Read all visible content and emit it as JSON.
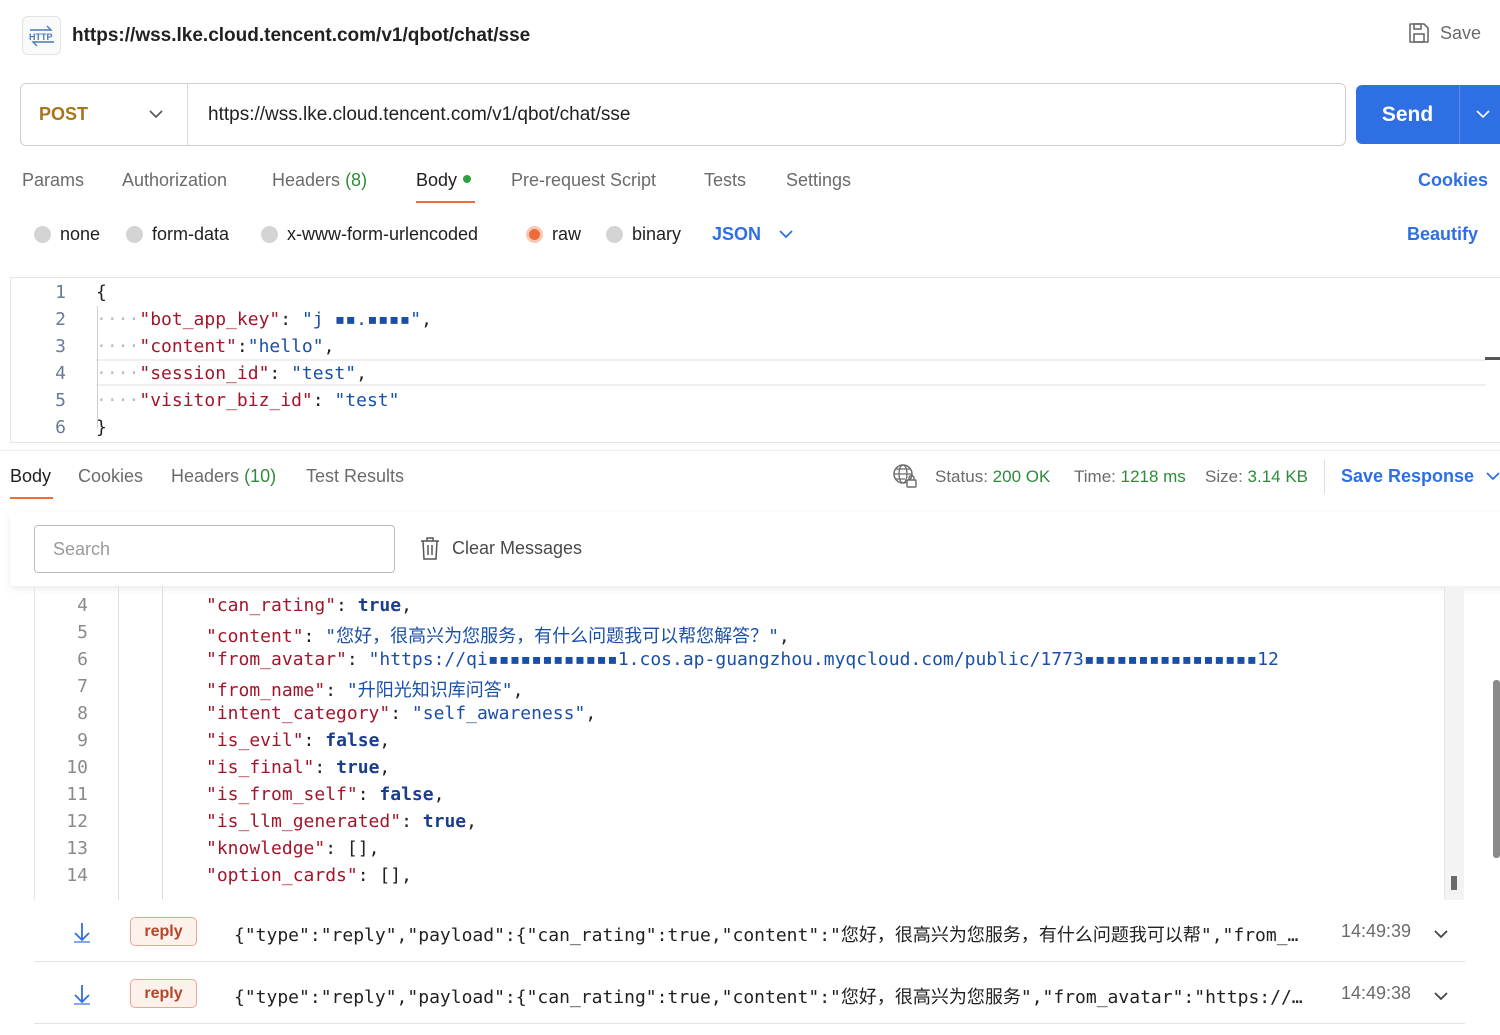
{
  "header": {
    "icon_label": "HTTP",
    "title": "https://wss.lke.cloud.tencent.com/v1/qbot/chat/sse",
    "save_label": "Save"
  },
  "request": {
    "method": "POST",
    "url": "https://wss.lke.cloud.tencent.com/v1/qbot/chat/sse",
    "send_label": "Send",
    "cookies_label": "Cookies",
    "tabs": [
      {
        "label": "Params"
      },
      {
        "label": "Authorization"
      },
      {
        "label": "Headers",
        "count": "(8)"
      },
      {
        "label": "Body"
      },
      {
        "label": "Pre-request Script"
      },
      {
        "label": "Tests"
      },
      {
        "label": "Settings"
      }
    ],
    "body_types": [
      "none",
      "form-data",
      "x-www-form-urlencoded",
      "raw",
      "binary"
    ],
    "selected_body_type": "raw",
    "format": "JSON",
    "beautify_label": "Beautify",
    "editor": {
      "line_numbers": [
        "1",
        "2",
        "3",
        "4",
        "5",
        "6"
      ],
      "open_brace": "{",
      "close_brace": "}",
      "fields": [
        {
          "key": "\"bot_app_key\"",
          "sep": ": ",
          "value": "\"j ▪▪.▪▪▪▪\"",
          "trail": ","
        },
        {
          "key": "\"content\"",
          "sep": ":",
          "value": "\"hello\"",
          "trail": ","
        },
        {
          "key": "\"session_id\"",
          "sep": ": ",
          "value": "\"test\"",
          "trail": ","
        },
        {
          "key": "\"visitor_biz_id\"",
          "sep": ": ",
          "value": "\"test\"",
          "trail": ""
        }
      ]
    }
  },
  "response": {
    "tabs": [
      {
        "label": "Body"
      },
      {
        "label": "Cookies"
      },
      {
        "label": "Headers",
        "count": "(10)"
      },
      {
        "label": "Test Results"
      }
    ],
    "status_label": "Status:",
    "status_value": "200 OK",
    "time_label": "Time:",
    "time_value": "1218 ms",
    "size_label": "Size:",
    "size_value": "3.14 KB",
    "save_response_label": "Save Response",
    "search_placeholder": "Search",
    "clear_messages_label": "Clear Messages",
    "viewer": {
      "lines": [
        {
          "n": "4",
          "key": "\"can_rating\"",
          "value": "true",
          "kind": "kw"
        },
        {
          "n": "5",
          "key": "\"content\"",
          "value": "\"您好，很高兴为您服务，有什么问题我可以帮您解答？\"",
          "kind": "str"
        },
        {
          "n": "6",
          "key": "\"from_avatar\"",
          "value": "\"https://qi▪▪▪▪▪▪▪▪▪▪▪▪1.cos.ap-guangzhou.myqcloud.com/public/1773▪▪▪▪▪▪▪▪▪▪▪▪▪▪▪▪12",
          "kind": "str"
        },
        {
          "n": "7",
          "key": "\"from_name\"",
          "value": "\"升阳光知识库问答\"",
          "kind": "str"
        },
        {
          "n": "8",
          "key": "\"intent_category\"",
          "value": "\"self_awareness\"",
          "kind": "str"
        },
        {
          "n": "9",
          "key": "\"is_evil\"",
          "value": "false",
          "kind": "kw"
        },
        {
          "n": "10",
          "key": "\"is_final\"",
          "value": "true",
          "kind": "kw"
        },
        {
          "n": "11",
          "key": "\"is_from_self\"",
          "value": "false",
          "kind": "kw"
        },
        {
          "n": "12",
          "key": "\"is_llm_generated\"",
          "value": "true",
          "kind": "kw"
        },
        {
          "n": "13",
          "key": "\"knowledge\"",
          "value": "[]",
          "kind": "plain"
        },
        {
          "n": "14",
          "key": "\"option_cards\"",
          "value": "[]",
          "kind": "plain"
        }
      ]
    },
    "messages": [
      {
        "type": "reply",
        "text": "{\"type\":\"reply\",\"payload\":{\"can_rating\":true,\"content\":\"您好，很高兴为您服务，有什么问题我可以帮\",\"from_…",
        "time": "14:49:39"
      },
      {
        "type": "reply",
        "text": "{\"type\":\"reply\",\"payload\":{\"can_rating\":true,\"content\":\"您好，很高兴为您服务\",\"from_avatar\":\"https://…",
        "time": "14:49:38"
      }
    ]
  },
  "colors": {
    "accent": "#2f6fe4",
    "method": "#a8741a",
    "active_tab_underline": "#ef6b3a",
    "status_ok": "#2e8b3a"
  },
  "icons": [
    "http-icon",
    "save-icon",
    "chevron-down-icon",
    "globe-lock-icon",
    "trash-icon",
    "arrow-down-icon"
  ]
}
